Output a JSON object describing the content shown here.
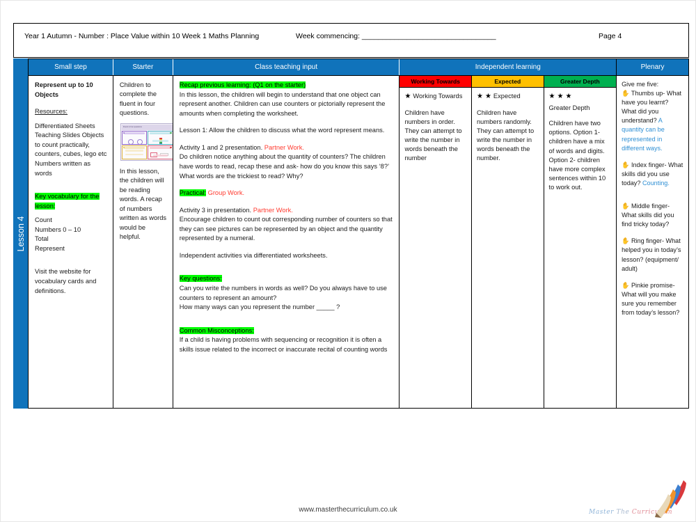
{
  "header": {
    "title": "Year 1 Autumn -  Number : Place Value within 10 Week 1 Maths Planning",
    "week_commencing": "Week commencing: _________________________________",
    "page_number": "Page 4"
  },
  "lesson_spine": {
    "label": "Lesson 4"
  },
  "columns": {
    "small_step": "Small step",
    "starter": "Starter",
    "class_teaching_input": "Class teaching input",
    "independent_learning": "Independent learning",
    "plenary": "Plenary"
  },
  "small_step": {
    "heading": "Represent up to 10 Objects",
    "resources_label": "Resources:",
    "resources": "Differentiated Sheets Teaching Slides Objects to count practically, counters, cubes, lego etc Numbers written as words",
    "key_vocab_label": "Key vocabulary for the lesson:",
    "vocab": [
      "Count",
      "Numbers 0 – 10",
      "Total",
      "Represent"
    ],
    "website_note": "Visit the website for vocabulary cards and definitions."
  },
  "starter": {
    "intro": "Children to complete the fluent in four questions.",
    "thumbnail_title": "Fluent in four questions",
    "note": "In this lesson, the children will be reading words. A recap of numbers written as words would be helpful."
  },
  "class_teaching_input": {
    "recap_label": "Recap previous learning: (Q1 on the starter)",
    "recap_body": "In this lesson, the children will begin to understand that one object can represent another. Children can use counters or pictorially represent the amounts when completing the worksheet.",
    "lesson1": "Lesson 1: Allow the children to discuss what the word represent means.",
    "activity12_main": "Activity 1 and 2 presentation.",
    "activity12_tag": "Partner Work.",
    "activity12_body": "Do children notice anything about the quantity of counters? The children have words to read, recap these and ask- how do you know this says ‘8?’ What words are the trickiest to read? Why?",
    "practical_label": "Practical:",
    "practical_tag": "Group Work.",
    "activity3_main": "Activity 3 in presentation.",
    "activity3_tag": "Partner Work.",
    "activity3_body": "Encourage children to count out corresponding number of counters so that they can see pictures can be represented by an object and the quantity represented by a numeral.",
    "independent_line": "Independent activities via differentiated worksheets.",
    "key_questions_label": "Key questions:",
    "key_questions": [
      "Can you write the numbers in words as well? Do you always have to use counters to represent an amount?",
      "How many ways can you represent the number _____ ?"
    ],
    "misconceptions_label": "Common Misconceptions:",
    "misconceptions_body": "If a child is having problems with sequencing or recognition it is often a skills issue related to the incorrect or inaccurate recital of counting words"
  },
  "independent_learning": [
    {
      "band_label": "Working Towards",
      "band_color": "#FF0000",
      "stars": 1,
      "star_label": "Working Towards",
      "body": "Children have numbers in order. They can attempt to write the number in words beneath the number"
    },
    {
      "band_label": "Expected",
      "band_color": "#FFC000",
      "stars": 2,
      "star_label": "Expected",
      "body": "Children have numbers randomly. They can attempt to write the number in words beneath the number."
    },
    {
      "band_label": "Greater Depth",
      "band_color": "#00B050",
      "stars": 3,
      "star_label": "Greater Depth",
      "body": "Children have two options. Option 1- children have a mix of words and digits. Option 2- children have more complex sentences within 10 to work out."
    }
  ],
  "plenary": {
    "title": "Give me five:",
    "items": [
      {
        "icon": "hand-icon",
        "question": "Thumbs up- What have you learnt? What did you understand?",
        "answer": "A quantity can be represented in different ways."
      },
      {
        "icon": "hand-icon",
        "question": "Index finger- What skills did you use today?",
        "answer": "Counting."
      },
      {
        "icon": "hand-icon",
        "question": "Middle finger- What skills did you find tricky today?",
        "answer": ""
      },
      {
        "icon": "hand-icon",
        "question": "Ring finger- What helped you in today’s lesson? (equipment/ adult)",
        "answer": ""
      },
      {
        "icon": "hand-icon",
        "question": "Pinkie promise- What will you make sure you remember from today’s lesson?",
        "answer": ""
      }
    ]
  },
  "footer": {
    "url": "www.masterthecurriculum.co.uk",
    "logo_word_1": "Master",
    "logo_word_2": "The",
    "logo_word_3": "Curriculum"
  },
  "colors": {
    "header_blue": "#1073BB",
    "highlight_green": "#00FF00",
    "red_text": "#FF3B30",
    "blue_answer": "#2E8FD4",
    "working_towards": "#FF0000",
    "expected": "#FFC000",
    "greater_depth": "#00B050"
  }
}
